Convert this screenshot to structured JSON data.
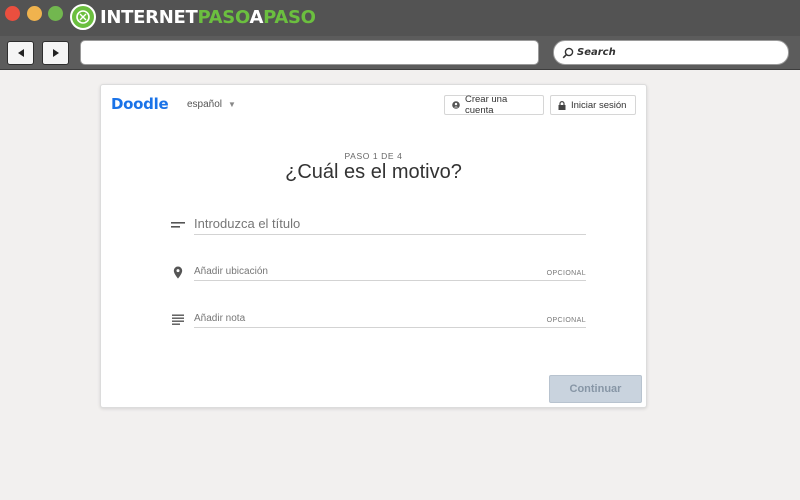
{
  "browser": {
    "logo_part_a": "INTERNET",
    "logo_part_b": "PASO",
    "logo_part_c": "A",
    "logo_part_d": "PASO",
    "search_placeholder": "Search"
  },
  "header": {
    "brand": "Doodle",
    "language": "español",
    "create_account": "Crear una cuenta",
    "login": "Iniciar sesión"
  },
  "main": {
    "step": "PASO 1 DE 4",
    "heading": "¿Cuál es el motivo?",
    "title_placeholder": "Introduzca el título",
    "location_placeholder": "Añadir ubicación",
    "location_optional": "OPCIONAL",
    "note_placeholder": "Añadir nota",
    "note_optional": "OPCIONAL",
    "continue_label": "Continuar"
  },
  "colors": {
    "brand": "#1a73e8",
    "logo_green": "#6bbf3f",
    "continue_bg": "#c9d3de"
  },
  "icons": {
    "title": "short-text-icon",
    "location": "location-pin-icon",
    "note": "notes-icon",
    "account": "user-icon",
    "login": "lock-icon"
  }
}
